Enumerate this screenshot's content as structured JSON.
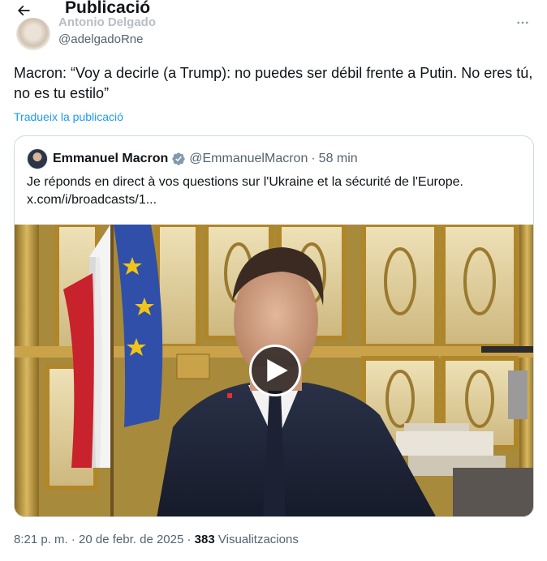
{
  "header": {
    "title": "Publicació",
    "back_icon": "arrow-left-icon"
  },
  "author": {
    "name": "Antonio Delgado",
    "handle": "@adelgadoRne",
    "more_icon": "more-dots-icon"
  },
  "post": {
    "text": "Macron: “Voy a decirle (a Trump): no puedes ser débil frente a Putin. No eres tú, no es tu estilo”",
    "translate_label": "Tradueix la publicació"
  },
  "quote": {
    "name": "Emmanuel Macron",
    "handle": "@EmmanuelMacron",
    "separator": "·",
    "time": "58 min",
    "text_line1": "Je réponds en direct à vos questions sur l'Ukraine et la sécurité de l'Europe.",
    "text_line2": "x.com/i/broadcasts/1...",
    "verified_icon": "verified-badge-icon",
    "play_icon": "play-icon"
  },
  "meta": {
    "time": "8:21 p. m.",
    "sep1": "·",
    "date": "20 de febr. de 2025",
    "sep2": "·",
    "views_count": "383",
    "views_label": "Visualitzacions"
  },
  "colors": {
    "accent": "#1d9bf0",
    "text": "#0f1419",
    "secondary": "#536471",
    "border": "#cfd9de"
  }
}
